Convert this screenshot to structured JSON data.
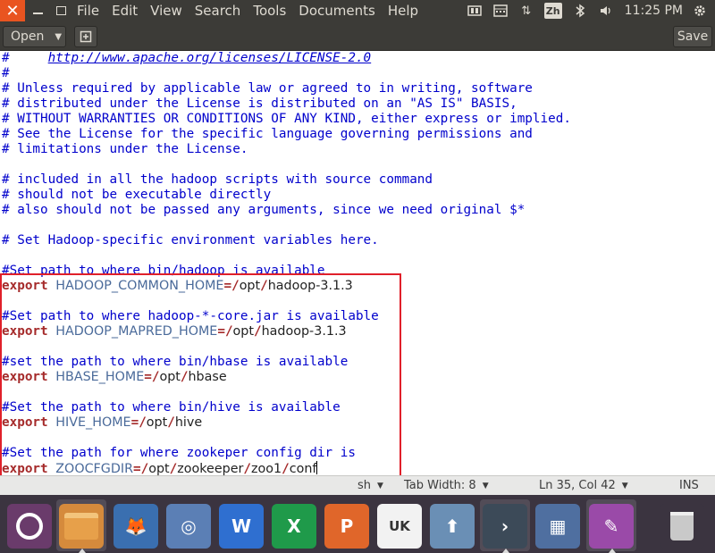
{
  "topbar": {
    "close_glyph": "✕",
    "menus": [
      "File",
      "Edit",
      "View",
      "Search",
      "Tools",
      "Documents",
      "Help"
    ],
    "zh_badge": "Zh",
    "clock": "11:25 PM"
  },
  "toolbar": {
    "open_label": "Open",
    "save_label": "Save"
  },
  "editor": {
    "lines": [
      {
        "type": "link",
        "prefix": "#     ",
        "text": "http://www.apache.org/licenses/LICENSE-2.0"
      },
      {
        "type": "comment",
        "text": "#"
      },
      {
        "type": "comment",
        "text": "# Unless required by applicable law or agreed to in writing, software"
      },
      {
        "type": "comment",
        "text": "# distributed under the License is distributed on an \"AS IS\" BASIS,"
      },
      {
        "type": "comment",
        "text": "# WITHOUT WARRANTIES OR CONDITIONS OF ANY KIND, either express or implied."
      },
      {
        "type": "comment",
        "text": "# See the License for the specific language governing permissions and"
      },
      {
        "type": "comment",
        "text": "# limitations under the License."
      },
      {
        "type": "blank",
        "text": ""
      },
      {
        "type": "comment",
        "text": "# included in all the hadoop scripts with source command"
      },
      {
        "type": "comment",
        "text": "# should not be executable directly"
      },
      {
        "type": "comment",
        "text": "# also should not be passed any arguments, since we need original $*"
      },
      {
        "type": "blank",
        "text": ""
      },
      {
        "type": "comment",
        "text": "# Set Hadoop-specific environment variables here."
      },
      {
        "type": "blank",
        "text": ""
      },
      {
        "type": "comment",
        "text": "#Set path to where bin/hadoop is available"
      },
      {
        "type": "export",
        "keyword": "export",
        "var": "HADOOP_COMMON_HOME",
        "path": [
          "opt",
          "hadoop-3.1.3"
        ]
      },
      {
        "type": "blank",
        "text": ""
      },
      {
        "type": "comment",
        "text": "#Set path to where hadoop-*-core.jar is available"
      },
      {
        "type": "export",
        "keyword": "export",
        "var": "HADOOP_MAPRED_HOME",
        "path": [
          "opt",
          "hadoop-3.1.3"
        ]
      },
      {
        "type": "blank",
        "text": ""
      },
      {
        "type": "comment",
        "text": "#set the path to where bin/hbase is available"
      },
      {
        "type": "export",
        "keyword": "export",
        "var": "HBASE_HOME",
        "path": [
          "opt",
          "hbase"
        ]
      },
      {
        "type": "blank",
        "text": ""
      },
      {
        "type": "comment",
        "text": "#Set the path to where bin/hive is available"
      },
      {
        "type": "export",
        "keyword": "export",
        "var": "HIVE_HOME",
        "path": [
          "opt",
          "hive"
        ]
      },
      {
        "type": "blank",
        "text": ""
      },
      {
        "type": "comment",
        "text": "#Set the path for where zookeper config dir is"
      },
      {
        "type": "export",
        "keyword": "export",
        "var": "ZOOCFGDIR",
        "path": [
          "opt",
          "zookeeper",
          "zoo1",
          "conf"
        ],
        "cursor": true
      }
    ]
  },
  "statusbar": {
    "language": "sh",
    "tab_width": "Tab Width: 8",
    "position": "Ln 35, Col 42",
    "mode": "INS"
  },
  "dock": {
    "items": [
      {
        "name": "ubuntu-dash-icon",
        "color": "#6a3b6b",
        "glyph": "◉"
      },
      {
        "name": "files-icon",
        "color": "#d58a3c",
        "glyph": "",
        "active": true
      },
      {
        "name": "firefox-icon",
        "color": "#3a6fb0",
        "glyph": "🦊"
      },
      {
        "name": "chromium-icon",
        "color": "#5b7fb5",
        "glyph": "◎"
      },
      {
        "name": "wps-writer-icon",
        "color": "#2f6fd0",
        "glyph": "W"
      },
      {
        "name": "wps-spreadsheets-icon",
        "color": "#1f9a4a",
        "glyph": "X"
      },
      {
        "name": "wps-presentation-icon",
        "color": "#e0662a",
        "glyph": "P"
      },
      {
        "name": "ubuntu-software-icon",
        "color": "#f2f2f2",
        "glyph": "UK"
      },
      {
        "name": "software-updater-icon",
        "color": "#6a8fb5",
        "glyph": "⬆"
      },
      {
        "name": "terminal-icon",
        "color": "#3c4a58",
        "glyph": "›",
        "active": true
      },
      {
        "name": "system-settings-icon",
        "color": "#4f6fa0",
        "glyph": "▦"
      },
      {
        "name": "text-editor-icon",
        "color": "#9a4aa8",
        "glyph": "✎",
        "active": true
      },
      {
        "name": "trash-icon",
        "color": "#3b3440",
        "glyph": "🗑"
      }
    ]
  }
}
